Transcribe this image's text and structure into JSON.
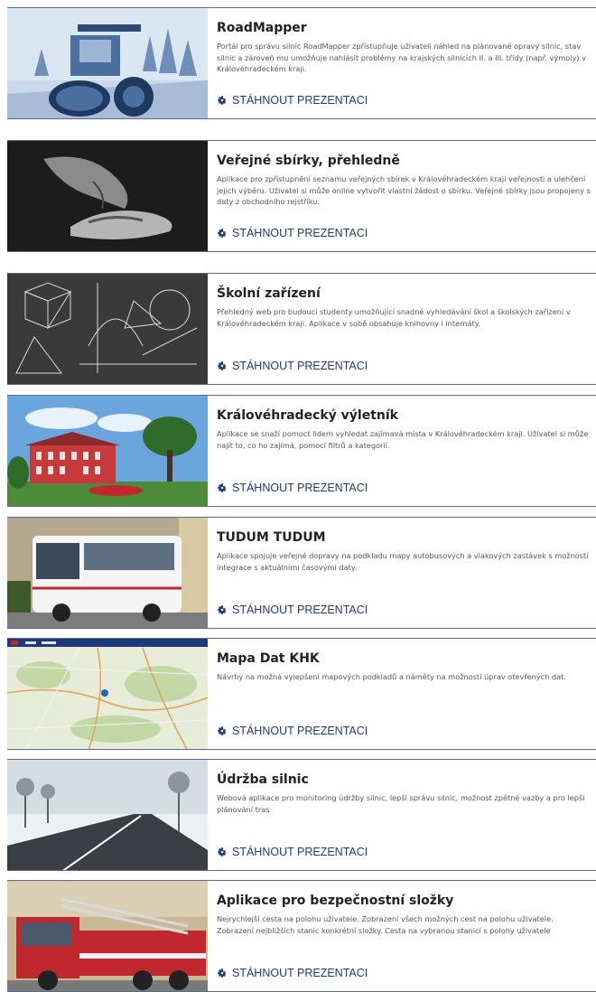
{
  "download_label": "STÁHNOUT PREZENTACI",
  "accent_color": "#1f3a7a",
  "cards": [
    {
      "title": "RoadMapper",
      "description": "Portál pro správu silnic RoadMapper zpřístupňuje uživateli náhled na plánované opravy silnic, stav silnic a zároveň mu umožňuje nahlásit problémy na krajských silnicích II. a III. třídy (např. výmoly) v Královéhradeckém kraji.",
      "image": "road-roller-image"
    },
    {
      "title": "Veřejné sbírky, přehledně",
      "description": "Aplikace pro zpřístupnění seznamu veřejných sbírek v Královéhradeckém kraji veřejnosti a ulehčení jejich výběru. Uživatel si může online vytvořit vlastní žádost o sbírku. Veřejné sbírky jsou propojeny s daty z obchodního rejstříku.",
      "image": "hands-image"
    },
    {
      "title": "Školní zařízení",
      "description": "Přehledný web pro budoucí studenty umožňující snadné vyhledávání škol a školských zařízení v Královéhradeckém kraji. Aplikace v sobě obsahuje knihovny i internáty.",
      "image": "chalkboard-image"
    },
    {
      "title": "Královéhradecký výletník",
      "description": "Aplikace se snaží pomoct lidem vyhledat zajímavá místa v Královéhradeckém kraji. Uživatel si může najít to, co ho zajímá, pomocí filtrů a kategorií.",
      "image": "chateau-image"
    },
    {
      "title": "TUDUM TUDUM",
      "description": "Aplikace spojuje veřejné dopravy na podkladu mapy autobusových a vlakových zastávek s možností integrace s aktuálními časovými daty.",
      "image": "bus-image"
    },
    {
      "title": "Mapa Dat KHK",
      "description": "Návrhy na možná vylepšení mapových podkladů a náměty na možnosti úprav otevřených dat.",
      "image": "map-image"
    },
    {
      "title": "Údržba silnic",
      "description": "Webová aplikace pro monitoring údržby silnic, lepší správu silnic, možnost zpětné vazby a pro lepší plánování tras",
      "image": "winter-road-image"
    },
    {
      "title": "Aplikace pro bezpečnostní složky",
      "description": "Nejrychlejší cesta na polohu uživatele. Zobrazení všech možných cest na polohu uživatele. Zobrazení nejbližších stanic konkrétní složky. Cesta na vybranou stanicí s polohy uživatele",
      "image": "fire-truck-image"
    }
  ]
}
